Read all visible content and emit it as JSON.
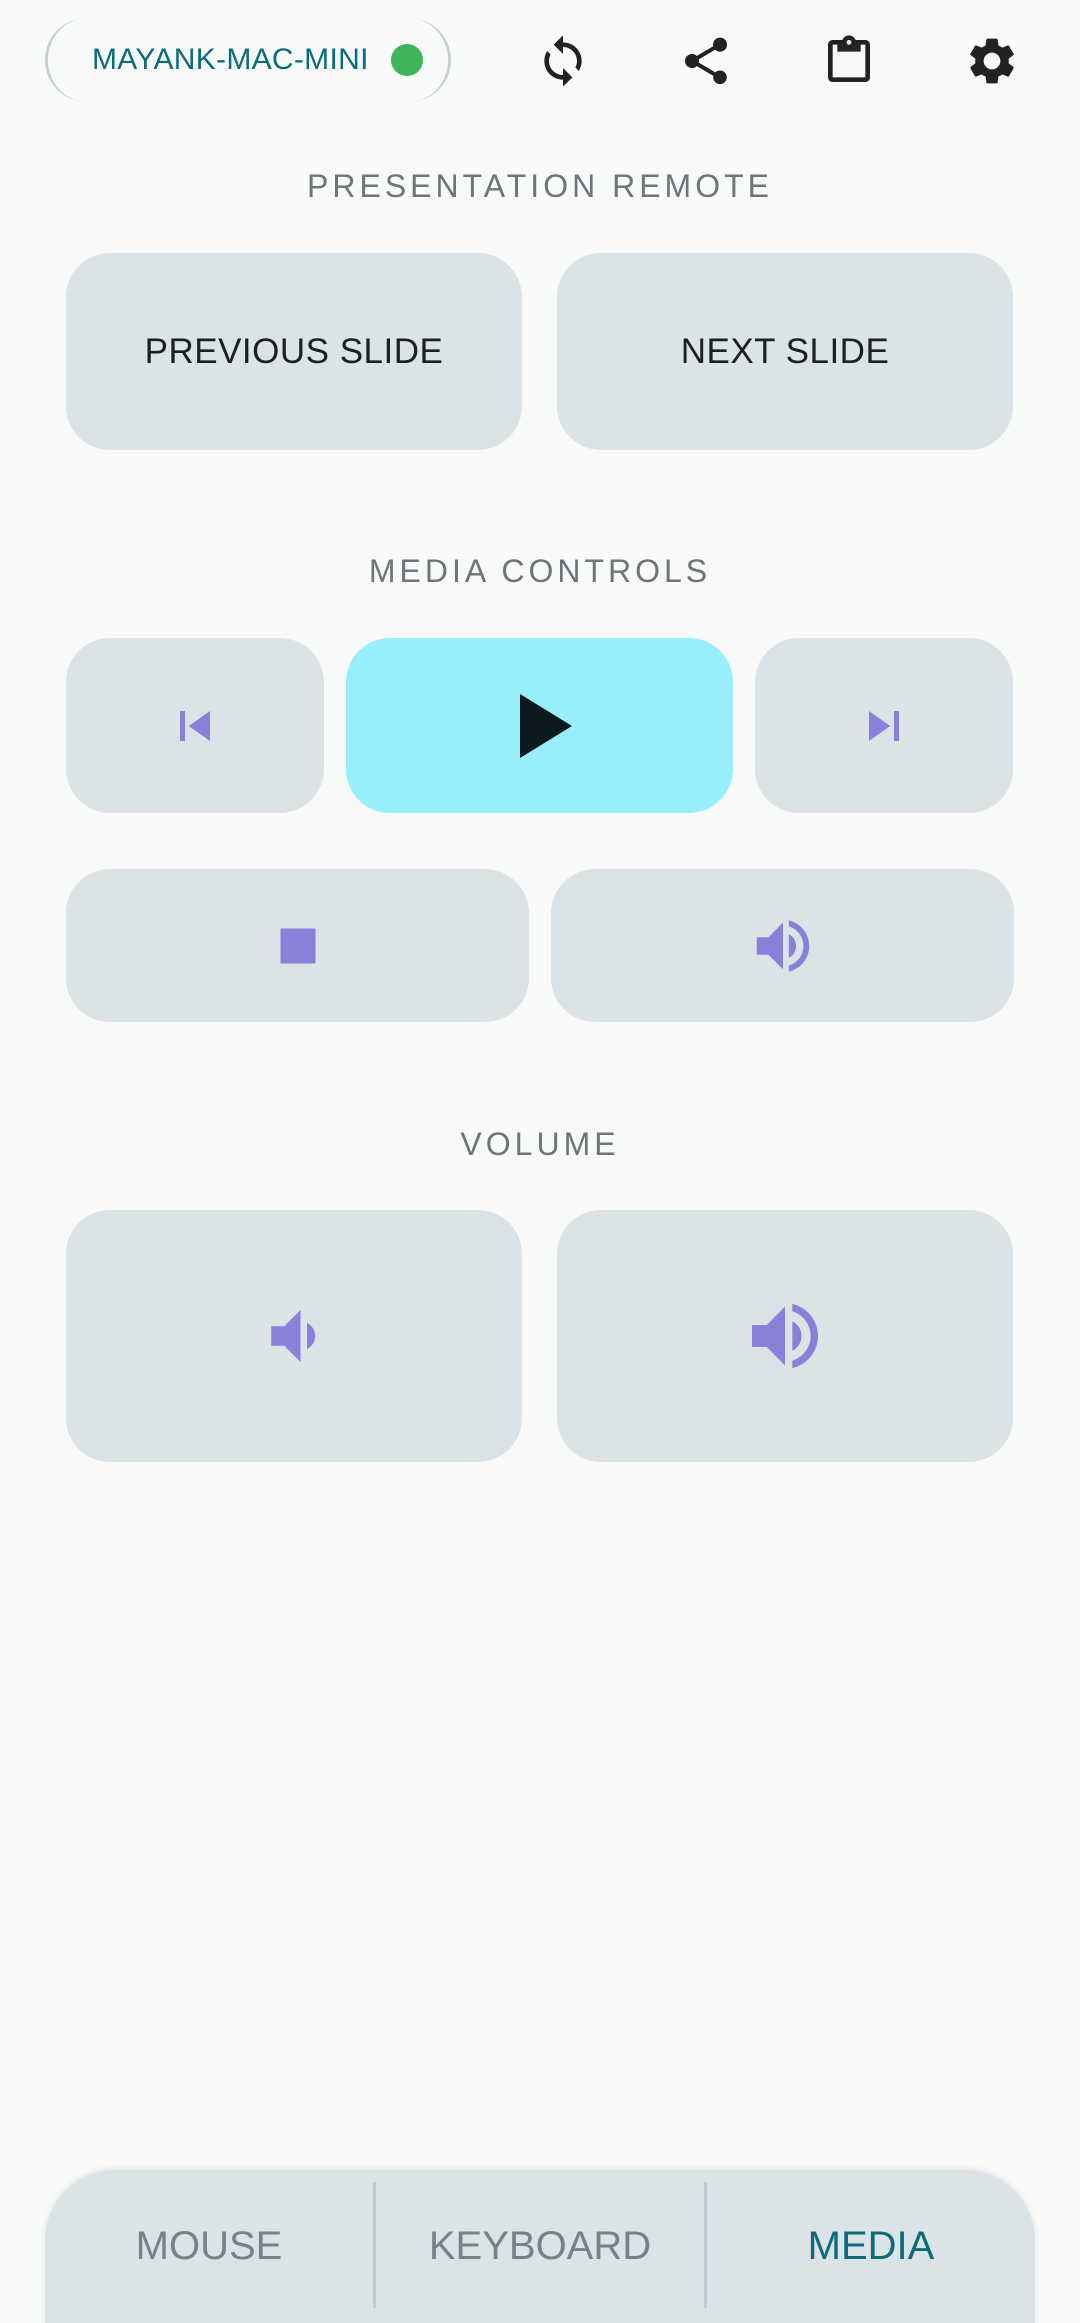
{
  "header": {
    "device_name": "MAYANK-MAC-MINI",
    "status": "connected",
    "status_color": "#3db35a",
    "icons": [
      "sync-icon",
      "share-icon",
      "clipboard-icon",
      "settings-icon"
    ]
  },
  "sections": {
    "presentation": {
      "title": "PRESENTATION REMOTE",
      "previous_label": "PREVIOUS SLIDE",
      "next_label": "NEXT SLIDE"
    },
    "media": {
      "title": "MEDIA CONTROLS",
      "buttons": [
        "skip-previous-icon",
        "play-icon",
        "skip-next-icon",
        "stop-icon",
        "volume-icon"
      ]
    },
    "volume": {
      "title": "VOLUME",
      "buttons": [
        "volume-down-icon",
        "volume-up-icon"
      ]
    }
  },
  "bottom_nav": {
    "tabs": [
      {
        "label": "MOUSE",
        "active": false
      },
      {
        "label": "KEYBOARD",
        "active": false
      },
      {
        "label": "MEDIA",
        "active": true
      }
    ]
  },
  "colors": {
    "accent": "#0b6b7a",
    "tile": "#dce3e6",
    "play_tile": "#99eefc",
    "icon": "#8a80d9"
  }
}
